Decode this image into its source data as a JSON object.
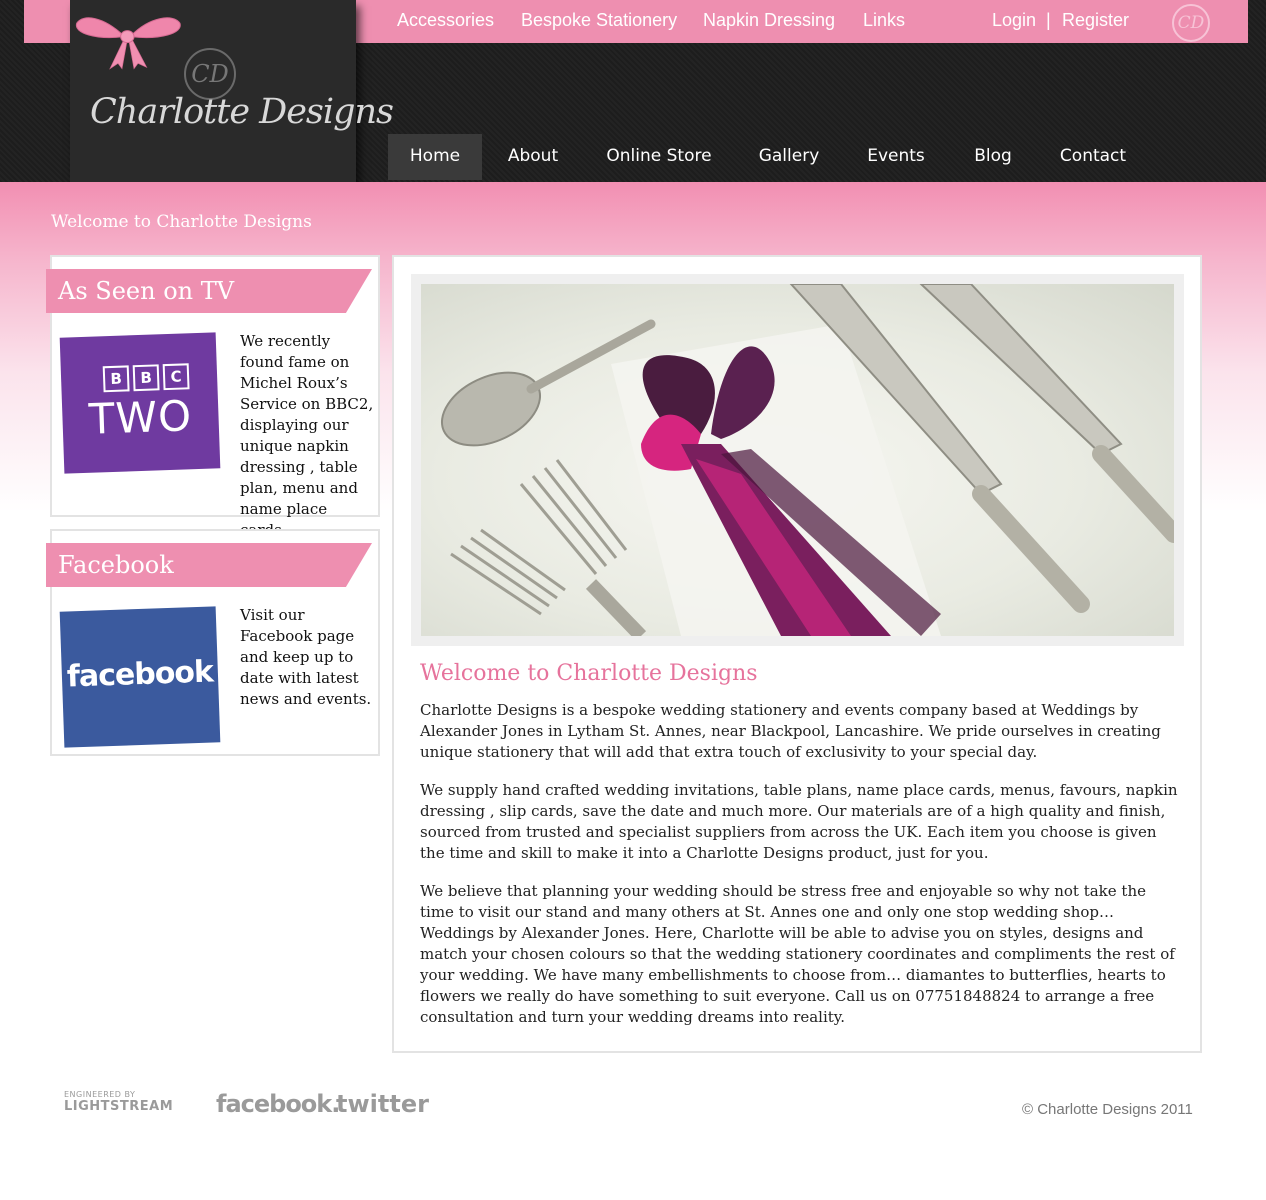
{
  "header": {
    "top_links": [
      "Accessories",
      "Bespoke Stationery",
      "Napkin Dressing",
      "Links"
    ],
    "login_label": "Login",
    "separator": "|",
    "register_label": "Register",
    "monogram": "CD",
    "logo_text": "Charlotte Designs",
    "logo_monogram": "CD",
    "nav": [
      "Home",
      "About",
      "Online Store",
      "Gallery",
      "Events",
      "Blog",
      "Contact"
    ],
    "active_nav": "Home"
  },
  "strap": "Welcome to Charlotte Designs",
  "sidebar": {
    "tv": {
      "title": "As Seen on TV",
      "text": "We recently found fame on Michel Roux’s Service on BBC2, displaying our unique napkin dressing , table plan, menu and name place cards.",
      "logo_letters": [
        "B",
        "B",
        "C"
      ],
      "logo_word": "TWO"
    },
    "facebook": {
      "title": "Facebook",
      "text": "Visit our Facebook page and keep up to date with latest news and events.",
      "logo_word": "facebook"
    }
  },
  "main": {
    "title": "Welcome to Charlotte Designs",
    "paragraphs": [
      "Charlotte Designs is a bespoke wedding stationery and events company based at Weddings by Alexander Jones in Lytham St. Annes, near Blackpool, Lancashire. We pride ourselves in creating unique stationery that will add that extra touch of exclusivity to your special day.",
      "We supply hand crafted wedding invitations, table plans, name place cards, menus, favours, napkin dressing , slip cards, save the date and much more. Our materials are of a high quality and finish, sourced from trusted and specialist suppliers from across the UK. Each item you choose is given the time and skill to make it into a Charlotte Designs product, just for you.",
      "We believe that planning your wedding should be stress free and enjoyable so why not take the time to visit our stand and many others at St. Annes one and only one stop wedding shop… Weddings by Alexander Jones. Here, Charlotte will be able to advise you on styles, designs and match your chosen colours so that the wedding stationery coordinates and compliments the rest of your wedding. We have many embellishments to choose from… diamantes to butterflies, hearts to flowers we really do have something to suit everyone. Call us on 07751848824 to arrange a free consultation and turn your wedding dreams into reality."
    ]
  },
  "footer": {
    "engineered_by": "ENGINEERED BY",
    "lightstream": "LIGHTSTREAM",
    "facebook": "facebook.",
    "twitter": "twitter",
    "copyright": "© Charlotte Designs 2011"
  },
  "colors": {
    "accent_pink": "#ee8fb0",
    "title_pink": "#e6739c",
    "header_dark": "#1d1d1d"
  }
}
